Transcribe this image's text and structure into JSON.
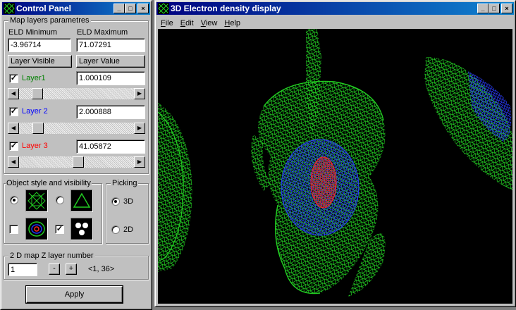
{
  "control_panel": {
    "title": "Control Panel",
    "map_layers": {
      "group_label": "Map layers parametres",
      "eld_min_label": "ELD Minimum",
      "eld_max_label": "ELD Maximum",
      "eld_min_value": "-3.96714",
      "eld_max_value": "71.07291",
      "col_visible": "Layer Visible",
      "col_value": "Layer Value",
      "layers": [
        {
          "name": "Layer1",
          "value": "1.000109",
          "checked": "✓",
          "color": "#008000"
        },
        {
          "name": "Layer 2",
          "value": "2.000888",
          "checked": "✓",
          "color": "#0000ff"
        },
        {
          "name": "Layer 3",
          "value": "41.05872",
          "checked": "✓",
          "color": "#ff0000"
        }
      ],
      "slider_levels": [
        0.12,
        0.13,
        0.52
      ]
    },
    "object_style": {
      "group_label": "Object style and visibility",
      "wire_check": "✓",
      "icons": [
        "wireframe-icon",
        "triangle-icon",
        "contour-icon",
        "dots-icon"
      ]
    },
    "picking": {
      "group_label": "Picking",
      "opt_3d": "3D",
      "opt_2d": "2D",
      "selected": "3D"
    },
    "z_layer": {
      "group_label": "2 D map Z layer number",
      "value": "1",
      "minus": "-",
      "plus": "+",
      "range": "<1, 36>"
    },
    "apply_label": "Apply"
  },
  "display": {
    "title": "3D Electron density display",
    "menu": [
      "File",
      "Edit",
      "View",
      "Help"
    ],
    "menu_underline": [
      "F",
      "E",
      "V",
      "H"
    ],
    "menu_rest": [
      "ile",
      "dit",
      "iew",
      "elp"
    ],
    "colors": {
      "outer": "#22cc22",
      "mid": "#2233ff",
      "inner": "#ff2222",
      "background": "#000000"
    }
  },
  "titlebar_buttons": {
    "minimize": "_",
    "maximize": "□",
    "close": "×"
  }
}
